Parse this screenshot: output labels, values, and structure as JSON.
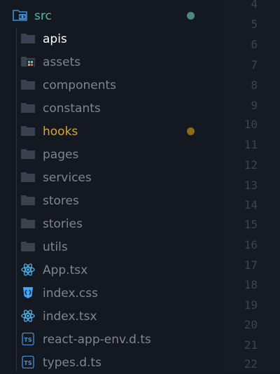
{
  "explorer": {
    "root": {
      "label": "src",
      "status": "modified"
    },
    "items": [
      {
        "label": "apis",
        "kind": "folder"
      },
      {
        "label": "assets",
        "kind": "folder-assets"
      },
      {
        "label": "components",
        "kind": "folder"
      },
      {
        "label": "constants",
        "kind": "folder"
      },
      {
        "label": "hooks",
        "kind": "folder",
        "status": "modified"
      },
      {
        "label": "pages",
        "kind": "folder"
      },
      {
        "label": "services",
        "kind": "folder"
      },
      {
        "label": "stores",
        "kind": "folder"
      },
      {
        "label": "stories",
        "kind": "folder"
      },
      {
        "label": "utils",
        "kind": "folder"
      },
      {
        "label": "App.tsx",
        "kind": "react"
      },
      {
        "label": "index.css",
        "kind": "css"
      },
      {
        "label": "index.tsx",
        "kind": "react"
      },
      {
        "label": "react-app-env.d.ts",
        "kind": "ts"
      },
      {
        "label": "types.d.ts",
        "kind": "ts"
      }
    ]
  },
  "gutter": {
    "line_numbers": [
      "4",
      "5",
      "6",
      "7",
      "8",
      "9",
      "10",
      "11",
      "12",
      "13",
      "14",
      "15",
      "16",
      "17",
      "18",
      "19",
      "20",
      "21",
      "22"
    ]
  },
  "colors": {
    "background": "#141820",
    "root_label": "#4fb9a8",
    "selected_label": "#ffffff",
    "hooks_label": "#d4a72c",
    "default_label": "#7d8694",
    "root_status_dot": "#4a8a84",
    "hooks_status_dot": "#8a6d1c",
    "line_number": "#3c4452"
  }
}
